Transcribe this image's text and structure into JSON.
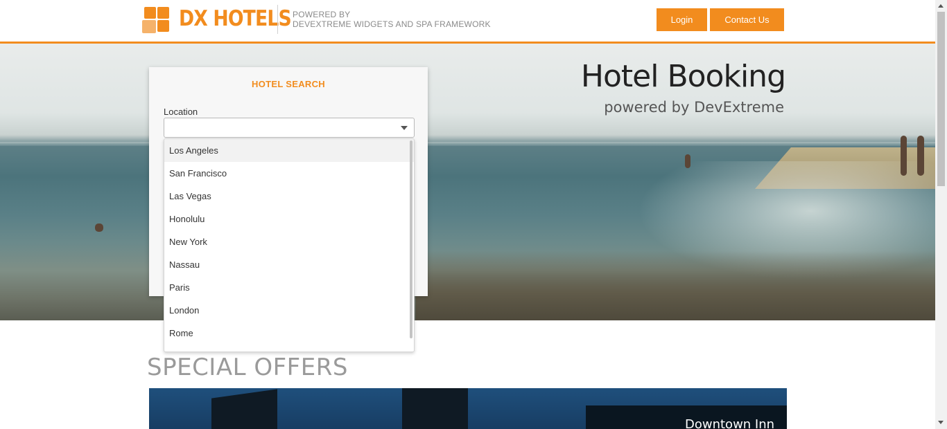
{
  "header": {
    "brand": "DX HOTELS",
    "powered_line1": "POWERED BY",
    "powered_line2": "DEVEXTREME WIDGETS AND SPA FRAMEWORK",
    "login_label": "Login",
    "contact_label": "Contact Us",
    "accent_color": "#f28c1e"
  },
  "hero": {
    "title": "Hotel Booking",
    "subtitle": "powered by DevExtreme"
  },
  "search": {
    "title": "HOTEL SEARCH",
    "location_label": "Location",
    "location_value": "",
    "dropdown_open": true,
    "options": [
      "Los Angeles",
      "San Francisco",
      "Las Vegas",
      "Honolulu",
      "New York",
      "Nassau",
      "Paris",
      "London",
      "Rome"
    ],
    "highlighted_option": "Los Angeles"
  },
  "offers": {
    "title": "SPECIAL OFFERS",
    "first_offer_name": "Downtown Inn"
  },
  "icons": {
    "logo": "dx-logo-squares-icon",
    "dropdown": "chevron-down-icon"
  }
}
